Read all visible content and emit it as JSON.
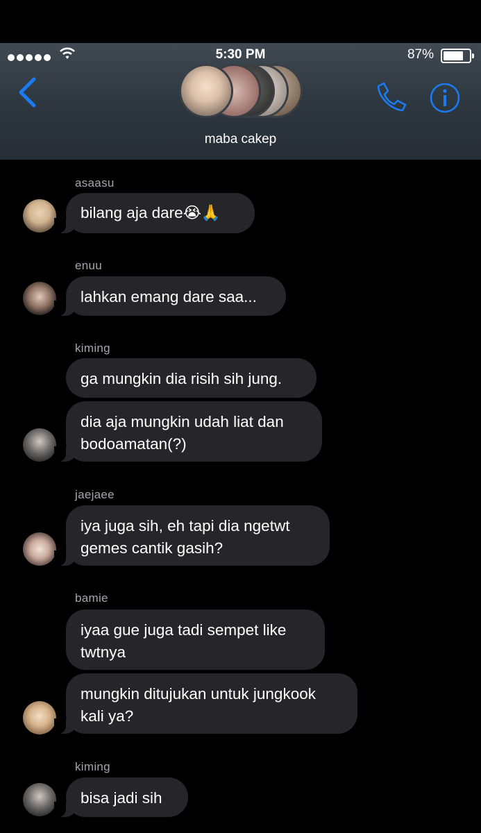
{
  "status_bar": {
    "time": "5:30 PM",
    "battery": "87%",
    "battery_level": 0.87
  },
  "header": {
    "group_name": "maba cakep",
    "back_icon": "chevron-left-icon",
    "call_icon": "phone-icon",
    "info_icon": "info-icon"
  },
  "messages": [
    {
      "sender": "asaasu",
      "bubbles": [
        "bilang aja dare😭🙏"
      ]
    },
    {
      "sender": "enuu",
      "bubbles": [
        "lahkan emang dare saa..."
      ]
    },
    {
      "sender": "kiming",
      "bubbles": [
        "ga mungkin dia risih sih jung.",
        "dia aja mungkin udah liat dan\nbodoamatan(?)"
      ]
    },
    {
      "sender": "jaejaee",
      "bubbles": [
        "iya juga sih, eh tapi dia ngetwt\ngemes cantik gasih?"
      ]
    },
    {
      "sender": "bamie",
      "bubbles": [
        "iyaa gue juga tadi sempet like\ntwtnya",
        "mungkin ditujukan untuk jungkook\nkali ya?"
      ]
    },
    {
      "sender": "kiming",
      "bubbles": [
        "bisa jadi sih"
      ]
    }
  ],
  "colors": {
    "bubble": "#26252a",
    "accent": "#1a7cf0",
    "sender": "#a6a6ab"
  }
}
